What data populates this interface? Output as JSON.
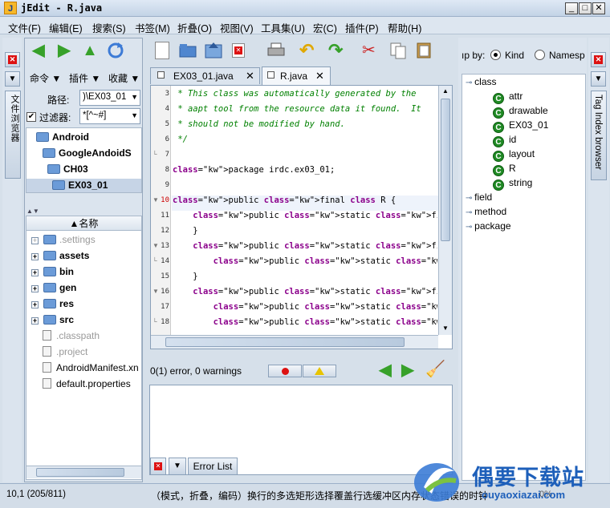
{
  "window": {
    "title": "jEdit - R.java"
  },
  "window_controls": {
    "minimize": "_",
    "maximize": "□",
    "close": "✕"
  },
  "menu": [
    "文件(F)",
    "编辑(E)",
    "搜索(S)",
    "书签(M)",
    "折叠(O)",
    "视图(V)",
    "工具集(U)",
    "宏(C)",
    "插件(P)",
    "帮助(H)"
  ],
  "left_dock": {
    "vertical_tab": "文件浏览器"
  },
  "browser": {
    "menu_labels": [
      "命令",
      "插件",
      "收藏"
    ],
    "path_label": "路径:",
    "path_value": ")\\EX03_01",
    "filter_label": "过滤器:",
    "filter_value": "*[^~#]",
    "parent_tree": [
      "Android",
      "GoogleAndoidS",
      "CH03",
      "EX03_01"
    ],
    "column_header": "▲名称",
    "files": [
      {
        "name": ".settings",
        "type": "folder",
        "dim": true
      },
      {
        "name": "assets",
        "type": "folder",
        "dim": false
      },
      {
        "name": "bin",
        "type": "folder",
        "dim": false
      },
      {
        "name": "gen",
        "type": "folder",
        "dim": false
      },
      {
        "name": "res",
        "type": "folder",
        "dim": false
      },
      {
        "name": "src",
        "type": "folder",
        "dim": false
      },
      {
        "name": ".classpath",
        "type": "file",
        "dim": true
      },
      {
        "name": ".project",
        "type": "file",
        "dim": true
      },
      {
        "name": "AndroidManifest.xn",
        "type": "file",
        "dim": false
      },
      {
        "name": "default.properties",
        "type": "file",
        "dim": false
      }
    ]
  },
  "tabs": [
    {
      "label": "EX03_01.java",
      "active": false
    },
    {
      "label": "R.java",
      "active": true
    }
  ],
  "code": {
    "lines": [
      {
        "n": "3",
        "text": " * This class was automatically generated by the"
      },
      {
        "n": "4",
        "text": " * aapt tool from the resource data it found.  It"
      },
      {
        "n": "5",
        "text": " * should not be modified by hand."
      },
      {
        "n": "6",
        "text": " */"
      },
      {
        "n": "7",
        "text": ""
      },
      {
        "n": "8",
        "text": "package irdc.ex03_01;"
      },
      {
        "n": "9",
        "text": ""
      },
      {
        "n": "10",
        "text": "public final class R {"
      },
      {
        "n": "11",
        "text": "    public static final class attr {"
      },
      {
        "n": "12",
        "text": "    }"
      },
      {
        "n": "13",
        "text": "    public static final class drawable {"
      },
      {
        "n": "14",
        "text": "        public static final int icon=0x7f020000;"
      },
      {
        "n": "15",
        "text": "    }"
      },
      {
        "n": "16",
        "text": "    public static final class id {"
      },
      {
        "n": "17",
        "text": "        public static final int myTextView01=0x7f0"
      },
      {
        "n": "18",
        "text": "        public static final int widget35=0x7f0500"
      }
    ]
  },
  "errors": {
    "summary": "0(1) error, 0 warnings",
    "footer_tab": "Error List"
  },
  "tag_index": {
    "group_by_label": "ıp by:",
    "options": [
      "Kind",
      "Namesp"
    ],
    "selected": "Kind",
    "vertical_tab": "Tag Index browser",
    "tree": [
      {
        "label": "class",
        "expanded": true,
        "children": [
          "attr",
          "drawable",
          "EX03_01",
          "id",
          "layout",
          "R",
          "string"
        ]
      },
      {
        "label": "field",
        "expanded": false
      },
      {
        "label": "method",
        "expanded": false
      },
      {
        "label": "package",
        "expanded": false
      }
    ],
    "badge_letter": "C"
  },
  "status": {
    "position": "10,1 (205/811)",
    "hint": "（模式，折叠，编码）换行的多选矩形选择覆盖行选缓冲区内存状态错误的时钟",
    "percent": "0%"
  },
  "watermark": {
    "brand": "偶要下载站",
    "url": "ouyaoxiazai.com"
  }
}
